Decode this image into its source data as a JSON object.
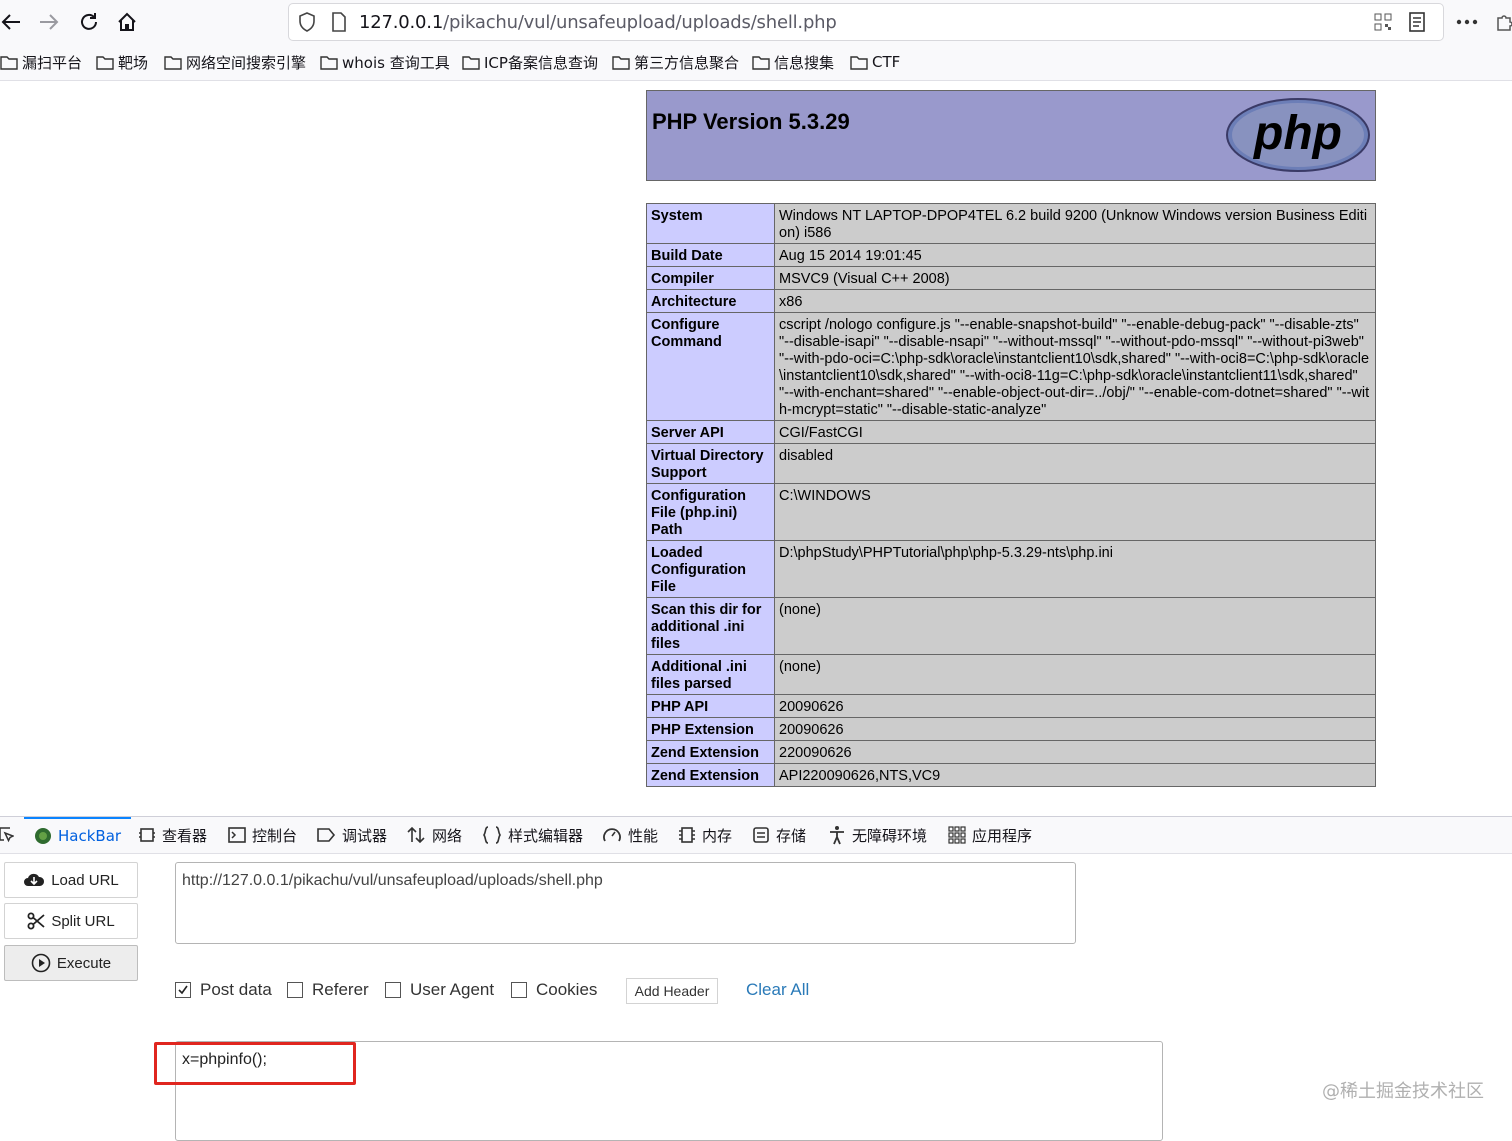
{
  "browser": {
    "url_host": "127.0.0.1",
    "url_path": "/pikachu/vul/unsafeupload/uploads/shell.php",
    "bookmarks": [
      "漏扫平台",
      "靶场",
      "网络空间搜索引擎",
      "whois 查询工具",
      "ICP备案信息查询",
      "第三方信息聚合",
      "信息搜集",
      "CTF"
    ]
  },
  "phpinfo": {
    "title": "PHP Version 5.3.29",
    "logo_text": "php",
    "rows": [
      {
        "key": "System",
        "value": "Windows NT LAPTOP-DPOP4TEL 6.2 build 9200 (Unknow Windows version Business Edition) i586"
      },
      {
        "key": "Build Date",
        "value": "Aug 15 2014 19:01:45"
      },
      {
        "key": "Compiler",
        "value": "MSVC9 (Visual C++ 2008)"
      },
      {
        "key": "Architecture",
        "value": "x86"
      },
      {
        "key": "Configure Command",
        "value": "cscript /nologo configure.js \"--enable-snapshot-build\" \"--enable-debug-pack\" \"--disable-zts\" \"--disable-isapi\" \"--disable-nsapi\" \"--without-mssql\" \"--without-pdo-mssql\" \"--without-pi3web\" \"--with-pdo-oci=C:\\php-sdk\\oracle\\instantclient10\\sdk,shared\" \"--with-oci8=C:\\php-sdk\\oracle\\instantclient10\\sdk,shared\" \"--with-oci8-11g=C:\\php-sdk\\oracle\\instantclient11\\sdk,shared\" \"--with-enchant=shared\" \"--enable-object-out-dir=../obj/\" \"--enable-com-dotnet=shared\" \"--with-mcrypt=static\" \"--disable-static-analyze\""
      },
      {
        "key": "Server API",
        "value": "CGI/FastCGI"
      },
      {
        "key": "Virtual Directory Support",
        "value": "disabled"
      },
      {
        "key": "Configuration File (php.ini) Path",
        "value": "C:\\WINDOWS"
      },
      {
        "key": "Loaded Configuration File",
        "value": "D:\\phpStudy\\PHPTutorial\\php\\php-5.3.29-nts\\php.ini"
      },
      {
        "key": "Scan this dir for additional .ini files",
        "value": "(none)"
      },
      {
        "key": "Additional .ini files parsed",
        "value": "(none)"
      },
      {
        "key": "PHP API",
        "value": "20090626"
      },
      {
        "key": "PHP Extension",
        "value": "20090626"
      },
      {
        "key": "Zend Extension",
        "value": "220090626"
      },
      {
        "key": "Zend Extension",
        "value": "API220090626,NTS,VC9"
      }
    ]
  },
  "devtools": {
    "tabs": [
      "HackBar",
      "查看器",
      "控制台",
      "调试器",
      "网络",
      "样式编辑器",
      "性能",
      "内存",
      "存储",
      "无障碍环境",
      "应用程序"
    ]
  },
  "hackbar": {
    "load_url": "Load URL",
    "split_url": "Split URL",
    "execute": "Execute",
    "url_value": "http://127.0.0.1/pikachu/vul/unsafeupload/uploads/shell.php",
    "post_data_label": "Post data",
    "post_data_checked": true,
    "referer_label": "Referer",
    "user_agent_label": "User Agent",
    "cookies_label": "Cookies",
    "add_header": "Add Header",
    "clear_all": "Clear All",
    "post_body": "x=phpinfo();"
  },
  "watermark": "@稀土掘金技术社区",
  "colors": {
    "php_header": "#9999cc",
    "php_key": "#ccccff",
    "php_value": "#cccccc",
    "highlight": "#e0261f",
    "accent": "#0a84ff"
  }
}
